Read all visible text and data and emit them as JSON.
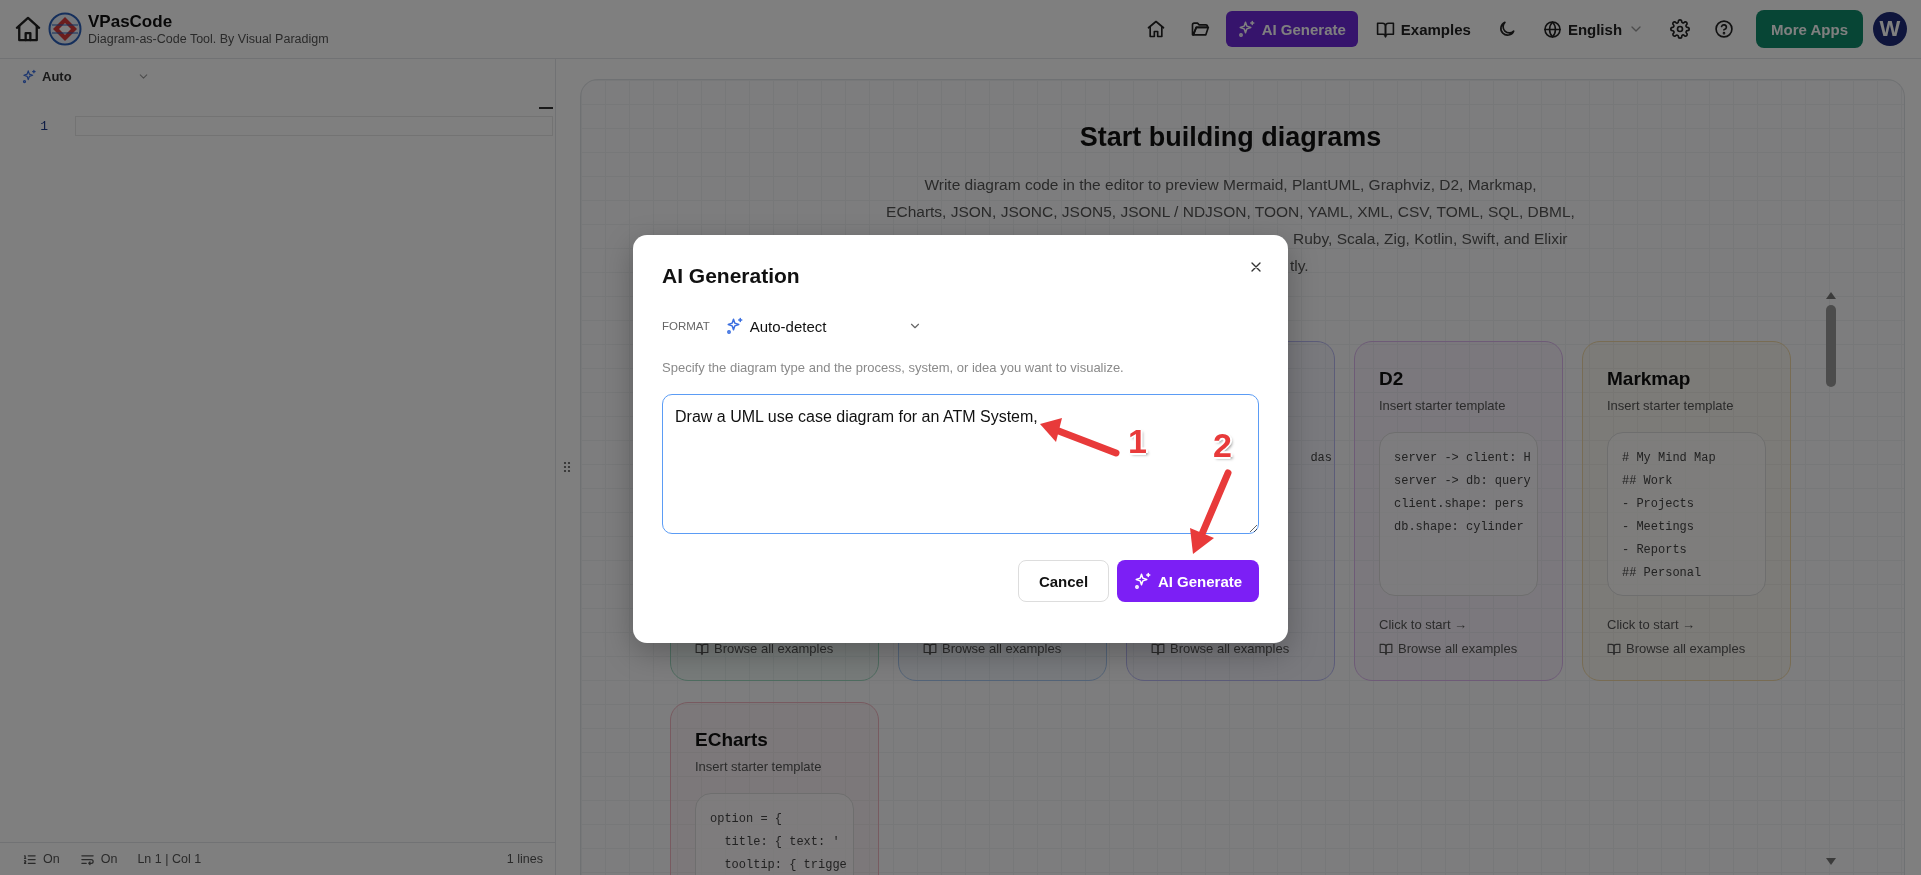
{
  "header": {
    "app_name": "VPasCode",
    "tagline": "Diagram-as-Code Tool. By Visual Paradigm",
    "ai_button": "AI Generate",
    "examples": "Examples",
    "language": "English",
    "more_apps": "More Apps",
    "avatar": "W"
  },
  "editor": {
    "mode": "Auto",
    "line_numbers": [
      "1"
    ],
    "status": [
      {
        "kind": "line-numbers",
        "text": "On"
      },
      {
        "kind": "wrap",
        "text": "On"
      },
      {
        "kind": "position",
        "text": "Ln 1 | Col 1"
      },
      {
        "kind": "count",
        "text": "1 lines"
      }
    ]
  },
  "preview": {
    "title": "Start building diagrams",
    "description_lines": [
      {
        "kind": "full",
        "text": "Write diagram code in the editor to preview Mermaid, PlantUML, Graphviz, D2, Markmap,"
      },
      {
        "kind": "full",
        "text": "ECharts, JSON, JSONC, JSON5, JSONL / NDJSON, TOON, YAML, XML, CSV, TOML, SQL, DBML,"
      },
      {
        "kind": "tail",
        "text": "Ruby, Scala, Zig, Kotlin, Swift, and Elixir"
      },
      {
        "kind": "end",
        "text": "tly."
      }
    ],
    "cards": [
      {
        "kind": "covered",
        "browse": "Browse all examples"
      },
      {
        "kind": "covered",
        "browse": "Browse all examples"
      },
      {
        "kind": "covered",
        "code": [
          "das"
        ],
        "browse": "Browse all examples"
      },
      {
        "kind": "full",
        "title": "D2",
        "subtitle": "Insert starter template",
        "code": [
          "server -> client: H",
          "server -> db: query",
          "client.shape: pers",
          "db.shape: cylinder"
        ],
        "start": "Click to start →",
        "browse": "Browse all examples"
      },
      {
        "kind": "full",
        "title": "Markmap",
        "subtitle": "Insert starter template",
        "code": [
          "# My Mind Map",
          "## Work",
          "- Projects",
          "- Meetings",
          "- Reports",
          "## Personal"
        ],
        "start": "Click to start →",
        "browse": "Browse all examples"
      },
      {
        "kind": "full",
        "title": "ECharts",
        "subtitle": "Insert starter template",
        "code": [
          "option = {",
          "  title: { text: '",
          "  tooltip: { trigge"
        ]
      }
    ]
  },
  "dialog": {
    "title": "AI Generation",
    "format_label": "FORMAT",
    "format_value": "Auto-detect",
    "hint": "Specify the diagram type and the process, system, or idea you want to visualize.",
    "prompt": "Draw a UML use case diagram for an ATM System,",
    "cancel": "Cancel",
    "generate": "AI Generate"
  },
  "annotations": [
    {
      "label": "1"
    },
    {
      "label": "2"
    }
  ]
}
